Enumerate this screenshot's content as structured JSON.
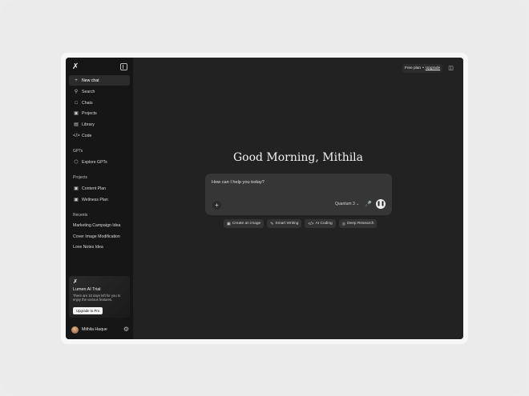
{
  "sidebar": {
    "items": [
      {
        "icon": "plus-icon",
        "label": "New chat"
      },
      {
        "icon": "search-icon",
        "label": "Search"
      },
      {
        "icon": "chat-bubble-icon",
        "label": "Chats"
      },
      {
        "icon": "folder-icon",
        "label": "Projects"
      },
      {
        "icon": "library-icon",
        "label": "Library"
      },
      {
        "icon": "code-icon",
        "label": "Code"
      }
    ],
    "gpts_heading": "GPTs",
    "gpts_items": [
      {
        "icon": "cube-icon",
        "label": "Explore GPTs"
      }
    ],
    "projects_heading": "Projects",
    "project_items": [
      {
        "icon": "folder-icon",
        "label": "Content Plan"
      },
      {
        "icon": "folder-icon",
        "label": "Wellness Plan"
      }
    ],
    "recents_heading": "Recents",
    "recents": [
      "Marketing Campaign Idea",
      "Cover Image Modification",
      "Love Notes Idea"
    ],
    "trial": {
      "title": "Lumen AI Trial",
      "description": "There are 10 days left for you to enjoy the various features.",
      "button": "Upgrade to Pro"
    },
    "user": {
      "name": "Mithila Haque"
    }
  },
  "header": {
    "plan_text": "Free plan",
    "plan_separator": "•",
    "upgrade_label": "Upgrade"
  },
  "main": {
    "greeting": "Good Morning, Mithila",
    "prompt_placeholder": "How can I help you today?",
    "model_label": "Quantum 3",
    "chips": [
      {
        "icon": "image-icon",
        "label": "Create an image"
      },
      {
        "icon": "pen-icon",
        "label": "Smart Writing"
      },
      {
        "icon": "code-icon",
        "label": "AI Coding"
      },
      {
        "icon": "globe-icon",
        "label": "Deep Research"
      }
    ]
  },
  "colors": {
    "background": "#1c1c1c",
    "sidebar": "#161616",
    "accent": "#f0f0f0"
  }
}
